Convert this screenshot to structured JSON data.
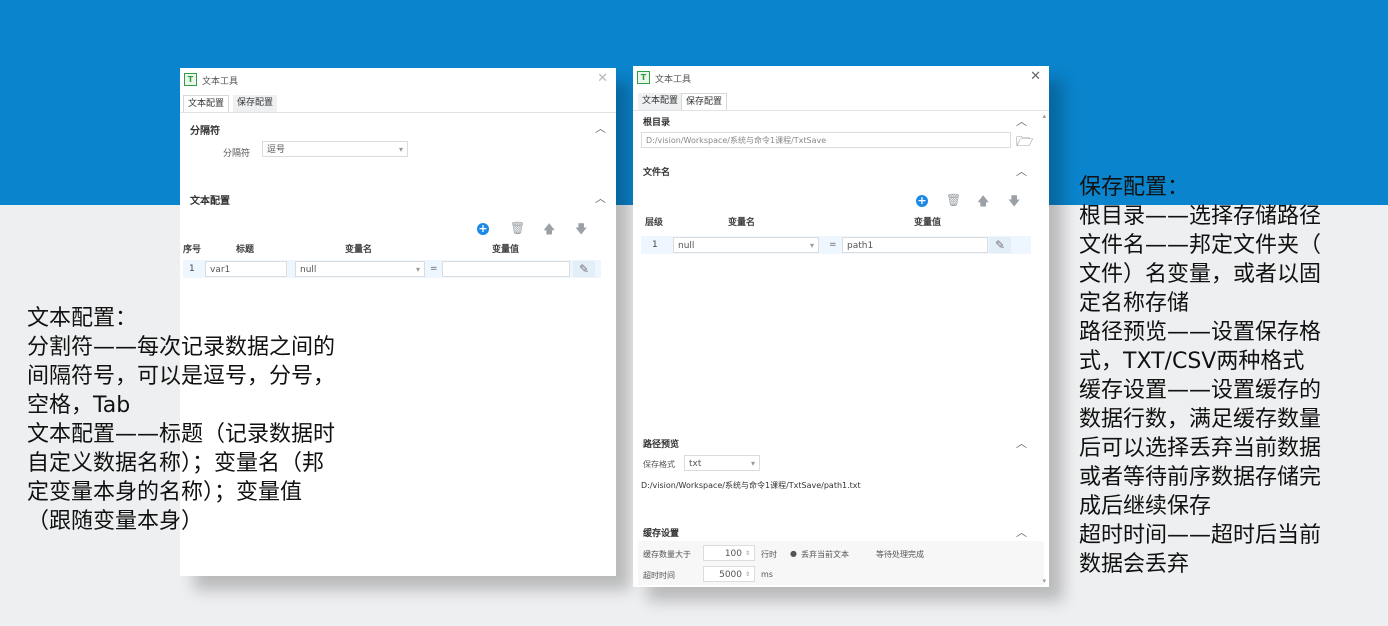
{
  "colors": {
    "banner": "#0a84cc",
    "accent": "#1e88e5"
  },
  "window1": {
    "title": "文本工具",
    "tabs": [
      "文本配置",
      "保存配置"
    ],
    "separator_section": {
      "title": "分隔符",
      "label": "分隔符",
      "value": "逗号"
    },
    "text_config_section": {
      "title": "文本配置",
      "columns": [
        "序号",
        "标题",
        "变量名",
        "变量值"
      ],
      "rows": [
        {
          "index": "1",
          "title": "var1",
          "variable": "null",
          "eq": "=",
          "value": ""
        }
      ]
    }
  },
  "window2": {
    "title": "文本工具",
    "tabs": [
      "文本配置",
      "保存配置"
    ],
    "root_section": {
      "title": "根目录",
      "path": "D:/vision/Workspace/系统与命令1课程/TxtSave"
    },
    "filename_section": {
      "title": "文件名",
      "columns": [
        "层级",
        "变量名",
        "变量值"
      ],
      "rows": [
        {
          "index": "1",
          "variable": "null",
          "eq": "=",
          "value": "path1"
        }
      ]
    },
    "path_preview_section": {
      "title": "路径预览",
      "format_label": "保存格式",
      "format_value": "txt",
      "preview": "D:/vision/Workspace/系统与命令1课程/TxtSave/path1.txt"
    },
    "cache_section": {
      "title": "缓存设置",
      "count_label": "缓存数量大于",
      "count_value": "100",
      "count_unit": "行时",
      "option_discard": "丢弃当前文本",
      "option_wait": "等待处理完成",
      "timeout_label": "超时时间",
      "timeout_value": "5000",
      "timeout_unit": "ms"
    }
  },
  "left_text": [
    "文本配置：",
    "分割符——每次记录数据之间的",
    "间隔符号，可以是逗号，分号，",
    "空格，Tab",
    "文本配置——标题（记录数据时",
    "自定义数据名称）；变量名（邦",
    "定变量本身的名称）；变量值",
    "（跟随变量本身）"
  ],
  "right_text": [
    "保存配置：",
    "根目录——选择存储路径",
    "文件名——邦定文件夹（",
    "文件）名变量，或者以固",
    "定名称存储",
    "路径预览——设置保存格",
    "式，TXT/CSV两种格式",
    "缓存设置——设置缓存的",
    "数据行数，满足缓存数量",
    "后可以选择丢弃当前数据",
    "或者等待前序数据存储完",
    "成后继续保存",
    "超时时间——超时后当前",
    "数据会丢弃"
  ]
}
